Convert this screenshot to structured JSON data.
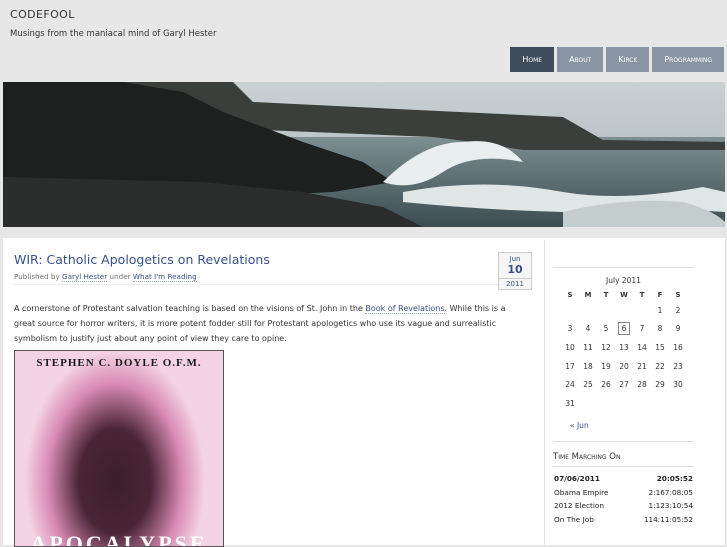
{
  "site": {
    "title": "CODEFOOL",
    "description": "Musings from the maniacal mind of Garyl Hester"
  },
  "nav": {
    "items": [
      "Home",
      "About",
      "Kirck",
      "Programming"
    ],
    "active": 0
  },
  "post": {
    "title": "WIR: Catholic Apologetics on Revelations",
    "meta_published_by": "Published by",
    "author": "Garyl Hester",
    "meta_under": "under",
    "category": "What I'm Reading",
    "date_month": "Jun",
    "date_day": "10",
    "date_year": "2011",
    "body_part1": "A cornerstone of Protestant salvation teaching is based on the visions of St. John in the",
    "body_link": "Book of Revelations",
    "body_part2": ". While this is a great source for horror writers, it is more potent fodder still for Protestant apologetics who use its vague and surrealistic symbolism to justify just about any point of view they care to opine.",
    "book_author": "STEPHEN C. DOYLE O.F.M.",
    "book_title": "APOCALYPSE"
  },
  "calendar": {
    "caption": "July 2011",
    "weekdays": [
      "S",
      "M",
      "T",
      "W",
      "T",
      "F",
      "S"
    ],
    "weeks": [
      [
        "",
        "",
        "",
        "",
        "",
        "1",
        "2"
      ],
      [
        "3",
        "4",
        "5",
        "6",
        "7",
        "8",
        "9"
      ],
      [
        "10",
        "11",
        "12",
        "13",
        "14",
        "15",
        "16"
      ],
      [
        "17",
        "18",
        "19",
        "20",
        "21",
        "22",
        "23"
      ],
      [
        "24",
        "25",
        "26",
        "27",
        "28",
        "29",
        "30"
      ],
      [
        "31",
        "",
        "",
        "",
        "",
        "",
        ""
      ]
    ],
    "today": "6",
    "prev_link": "« Jun"
  },
  "time_marching": {
    "heading": "Time Marching On",
    "rows": [
      {
        "label": "07/06/2011",
        "value": "20:05:52"
      },
      {
        "label": "Obama Empire",
        "value": "2:167:08:05"
      },
      {
        "label": "2012 Election",
        "value": "1:123:10:54"
      },
      {
        "label": "On The Job",
        "value": "114:11:05:52"
      }
    ]
  },
  "colors": {
    "nav_active": "#3f4c5b",
    "nav_inactive": "#8a95a3",
    "link": "#36508a"
  }
}
